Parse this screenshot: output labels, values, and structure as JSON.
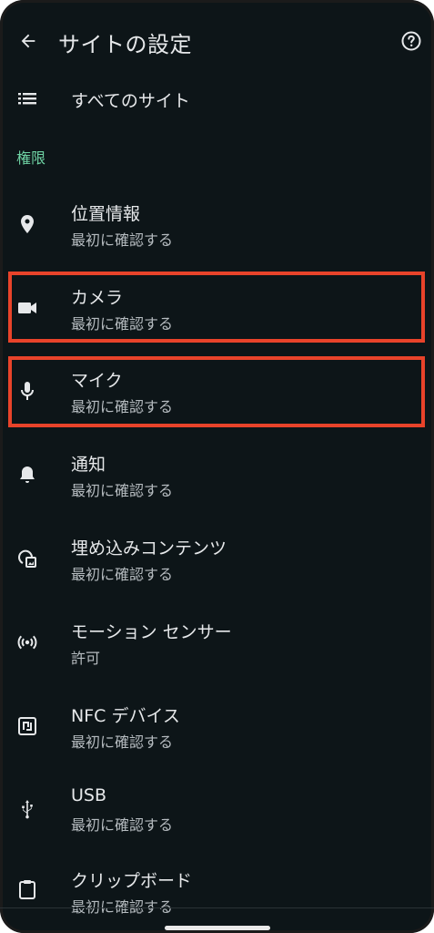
{
  "appbar": {
    "title": "サイトの設定",
    "back_icon": "arrow-back-icon",
    "help_icon": "help-circle-icon"
  },
  "all_sites": {
    "label": "すべてのサイト",
    "icon": "list-icon"
  },
  "section": {
    "label": "権限"
  },
  "items": [
    {
      "title": "位置情報",
      "subtitle": "最初に確認する",
      "icon": "location-pin-icon"
    },
    {
      "title": "カメラ",
      "subtitle": "最初に確認する",
      "icon": "video-camera-icon"
    },
    {
      "title": "マイク",
      "subtitle": "最初に確認する",
      "icon": "microphone-icon"
    },
    {
      "title": "通知",
      "subtitle": "最初に確認する",
      "icon": "bell-icon"
    },
    {
      "title": "埋め込みコンテンツ",
      "subtitle": "最初に確認する",
      "icon": "embedded-content-icon"
    },
    {
      "title": "モーション センサー",
      "subtitle": "許可",
      "icon": "motion-sensor-icon"
    },
    {
      "title": "NFC デバイス",
      "subtitle": "最初に確認する",
      "icon": "nfc-icon"
    },
    {
      "title": "USB",
      "subtitle": "最初に確認する",
      "icon": "usb-icon"
    },
    {
      "title": "クリップボード",
      "subtitle": "最初に確認する",
      "icon": "clipboard-icon"
    }
  ],
  "colors": {
    "background": "#0d1518",
    "text_primary": "#e6e8ea",
    "text_secondary": "#b6bcc0",
    "section_accent": "#6fd3a4",
    "highlight": "#e8432a"
  }
}
